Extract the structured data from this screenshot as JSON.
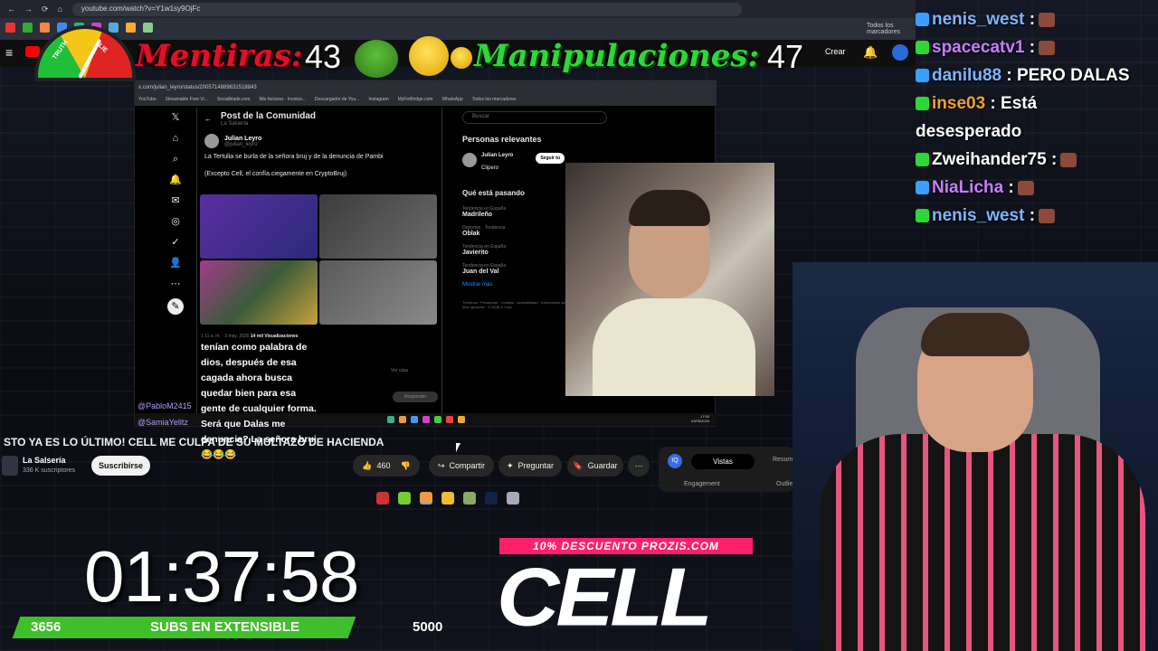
{
  "browser": {
    "url": "youtube.com/watch?v=Y1w1sy9OjFc",
    "bookmarks_label": "Todos los marcadores",
    "create_label": "Crear"
  },
  "overlay": {
    "gauge_truth": "TRUTH",
    "gauge_lie": "LIE",
    "lies_label": "Mentiras:",
    "lies_count": "43",
    "manip_label": "Manipulaciones:",
    "manip_count": "47"
  },
  "embedded": {
    "url": "x.com/julian_leyro/status/2005714889631518843",
    "bookmarks": [
      "YouTube",
      "Streamable Free Vi...",
      "Socialblade.com",
      "Mis facturas - Invoice...",
      "Descargador de You...",
      "Instagram",
      "MyFinBridge.com",
      "WhatsApp",
      "Todos los marcadores"
    ],
    "post_title": "Post de la Comunidad",
    "post_subtitle": "La Salsería",
    "author": "Julian Leyro",
    "handle": "@julian_leyro",
    "text1": "La Tertulia se burla de la señora bruj y de la denuncia de Pambi",
    "text2": "(Excepto Cell, el confía ciegamente en CryptoBruj)",
    "timestamp": "1:11 a. m. · 3 may. 2026",
    "views": "14 mil Visualizaciones",
    "reply_btn": "Responder",
    "ver_citas": "Ver citas",
    "search_placeholder": "Buscar",
    "relevant_title": "Personas relevantes",
    "relevant_name": "Julian Leyro",
    "relevant_bio": "Clipero",
    "follow_btn": "Seguir tú",
    "happening_title": "Qué está pasando",
    "trends": [
      {
        "sub": "Tendencia en España",
        "title": "Madrileño"
      },
      {
        "sub": "Deportes · Tendencia",
        "title": "Oblak"
      },
      {
        "sub": "Tendencia en España",
        "title": "Javierito"
      },
      {
        "sub": "Tendencia en España",
        "title": "Juan del Val"
      }
    ],
    "show_more": "Mostrar más",
    "footer": "Términos · Privacidad · Cookies · Accesibilidad · Información sobre anuncios · Más opciones · © 2026 X Corp.",
    "chat_overlay": "tenían como palabra de dios, después de esa cagada ahora busca quedar bien para esa gente de cualquier forma. Será que Dalas me denuncia? La señora bruj 😂😂😂",
    "chat_user1": "@PabloM2415",
    "chat_user2": "@SamiaYelitz",
    "clock": "17:50",
    "date": "03/05/2026"
  },
  "youtube": {
    "title": "STO YA ES LO ÚLTIMO! CELL ME CULPA DE SU MULTAZO DE HACIENDA",
    "channel": "La Salsería",
    "subscribers": "336 K suscriptores",
    "subscribe": "Suscribirse",
    "likes": "460",
    "share": "Compartir",
    "ask": "Preguntar",
    "save": "Guardar",
    "tab_views": "Vistas",
    "tab_summary": "Resum",
    "engagement": "Engagement",
    "outlier": "Outlie"
  },
  "chat": [
    {
      "user": "nenis_west",
      "text": " :",
      "color": "#7fb4ff",
      "emote": true
    },
    {
      "user": "spacecatv1",
      "text": " :",
      "color": "#c77dff",
      "emote": true
    },
    {
      "user": "danilu88",
      "text": " : PERO DALAS",
      "color": "#7fb4ff",
      "emote": false
    },
    {
      "user": "inse03",
      "text": " : Está",
      "color": "#f0a030",
      "emote": false
    },
    {
      "user": "",
      "text": "desesperado",
      "color": "#ffffff",
      "emote": false
    },
    {
      "user": "Zweihander75",
      "text": " :",
      "color": "#ffffff",
      "emote": true
    },
    {
      "user": "NiaLicha",
      "text": " :",
      "color": "#c77dff",
      "emote": true
    },
    {
      "user": "nenis_west",
      "text": " :",
      "color": "#7fb4ff",
      "emote": true
    }
  ],
  "timer": "01:37:58",
  "subs": {
    "current": "3656",
    "label": "SUBS EN EXTENSIBLE",
    "goal": "5000",
    "progress_fraction": 0.731
  },
  "promo": "10% DESCUENTO PROZIS.COM",
  "brand": "CELL",
  "colors": {
    "lies": "#e0102a",
    "manip": "#2fd63a",
    "promo": "#ff1f6b",
    "subs_bar": "#3fbf2a"
  }
}
